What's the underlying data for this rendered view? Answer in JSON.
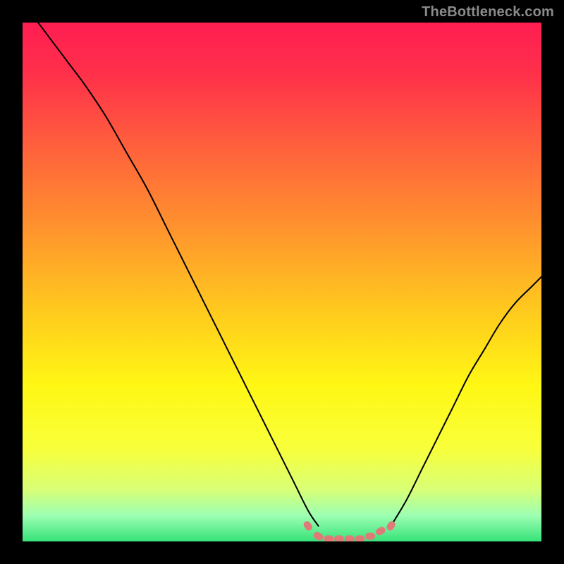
{
  "watermark": "TheBottleneck.com",
  "gradient_stops": [
    {
      "offset": 0.0,
      "color": "#ff1e52"
    },
    {
      "offset": 0.1,
      "color": "#ff304a"
    },
    {
      "offset": 0.22,
      "color": "#ff5a3e"
    },
    {
      "offset": 0.38,
      "color": "#ff8e2f"
    },
    {
      "offset": 0.55,
      "color": "#ffc81e"
    },
    {
      "offset": 0.7,
      "color": "#fff714"
    },
    {
      "offset": 0.82,
      "color": "#f8ff3a"
    },
    {
      "offset": 0.9,
      "color": "#d8ff76"
    },
    {
      "offset": 0.95,
      "color": "#9dffb2"
    },
    {
      "offset": 1.0,
      "color": "#36e27a"
    }
  ],
  "chart_data": {
    "type": "line",
    "title": "",
    "xlabel": "",
    "ylabel": "",
    "xlim": [
      0,
      100
    ],
    "ylim": [
      0,
      100
    ],
    "series": [
      {
        "name": "bottleneck-curve-left",
        "stroke": "#000000",
        "stroke_width": 2,
        "x": [
          3,
          6,
          9,
          12,
          16,
          20,
          24,
          28,
          32,
          36,
          40,
          44,
          48,
          52,
          55,
          57
        ],
        "y": [
          100,
          96,
          92,
          88,
          82,
          75,
          68,
          60,
          52,
          44,
          36,
          28,
          20,
          12,
          6,
          3
        ]
      },
      {
        "name": "flat-dotted-bottom",
        "stroke": "#e07a78",
        "stroke_width": 10,
        "style": "dotted",
        "x": [
          55,
          57,
          59,
          61,
          63,
          65,
          67,
          69,
          71
        ],
        "y": [
          3,
          1,
          0.5,
          0.5,
          0.5,
          0.5,
          1,
          2,
          3
        ]
      },
      {
        "name": "bottleneck-curve-right",
        "stroke": "#000000",
        "stroke_width": 2,
        "x": [
          71,
          74,
          77,
          80,
          83,
          86,
          89,
          92,
          95,
          98,
          100
        ],
        "y": [
          3,
          8,
          14,
          20,
          26,
          32,
          37,
          42,
          46,
          49,
          51
        ]
      }
    ]
  }
}
